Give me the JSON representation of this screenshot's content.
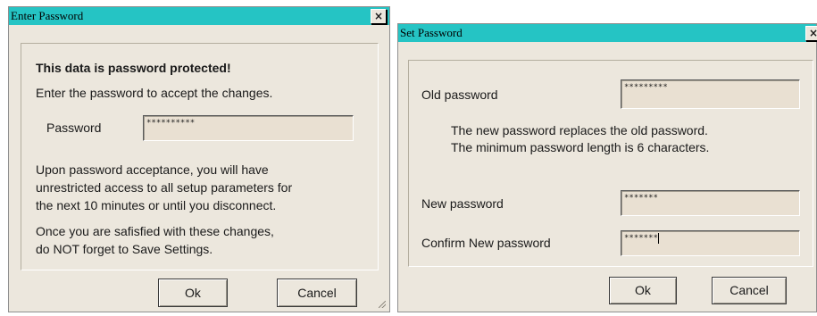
{
  "enter_dialog": {
    "title": "Enter Password",
    "close_glyph": "×",
    "heading": "This data is password protected!",
    "instruction": "Enter the password to accept the changes.",
    "password_label": "Password",
    "password_value": "**********",
    "info_lines": [
      "Upon password acceptance, you will have",
      "unrestricted access to all setup parameters for",
      "the next 10 minutes or until you disconnect."
    ],
    "reminder_lines": [
      "Once you are safisfied with these changes,",
      "do NOT forget to Save Settings."
    ],
    "ok_label": "Ok",
    "cancel_label": "Cancel"
  },
  "set_dialog": {
    "title": "Set Password",
    "close_glyph": "×",
    "old_password_label": "Old password",
    "old_password_value": "*********",
    "note_lines": [
      "The new password replaces the old password.",
      "The minimum password length is 6 characters."
    ],
    "new_password_label": "New password",
    "new_password_value": "*******",
    "confirm_password_label": "Confirm New password",
    "confirm_password_value": "*******",
    "ok_label": "Ok",
    "cancel_label": "Cancel"
  },
  "colors": {
    "titlebar": "#25c4c4",
    "dialog_face": "#ece7dd",
    "field_background": "#e9e0d2"
  },
  "icons": {
    "close": "close-icon",
    "resize_grip": "resize-grip-icon"
  }
}
